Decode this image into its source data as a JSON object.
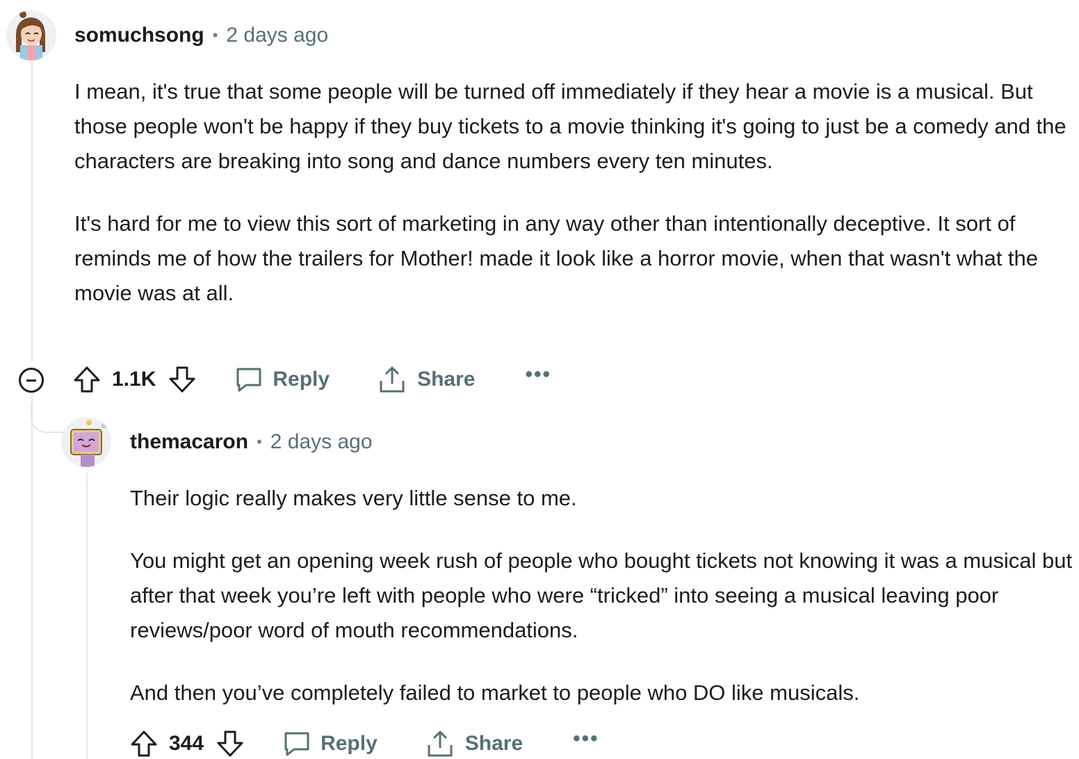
{
  "comments": [
    {
      "username": "somuchsong",
      "time": "2 days ago",
      "separator": "•",
      "paragraphs": [
        "I mean, it's true that some people will be turned off immediately if they hear a movie is a musical. But those people won't be happy if they buy tickets to a movie thinking it's going to just be a comedy and the characters are breaking into song and dance numbers every ten minutes.",
        "It's hard for me to view this sort of marketing in any way other than intentionally deceptive. It sort of reminds me of how the trailers for Mother! made it look like a horror movie, when that wasn't what the movie was at all."
      ],
      "score": "1.1K",
      "reply_label": "Reply",
      "share_label": "Share",
      "more_label": "•••"
    },
    {
      "username": "themacaron",
      "time": "2 days ago",
      "separator": "•",
      "paragraphs": [
        "Their logic really makes very little sense to me.",
        "You might get an opening week rush of people who bought tickets not knowing it was a musical but after that week you’re left with people who were “tricked” into seeing a musical leaving poor reviews/poor word of mouth recommendations.",
        "And then you’ve completely failed to market to people who DO like musicals."
      ],
      "score": "344",
      "reply_label": "Reply",
      "share_label": "Share",
      "more_label": "•••"
    }
  ],
  "icons": {
    "upvote": "arrow-up-outline",
    "downvote": "arrow-down-outline",
    "reply": "speech-bubble",
    "share": "share-tray-arrow-up",
    "collapse": "circle-minus"
  },
  "colors": {
    "text": "#1c1c1c",
    "muted": "#576f76",
    "thread_line": "#e5e7e9"
  }
}
